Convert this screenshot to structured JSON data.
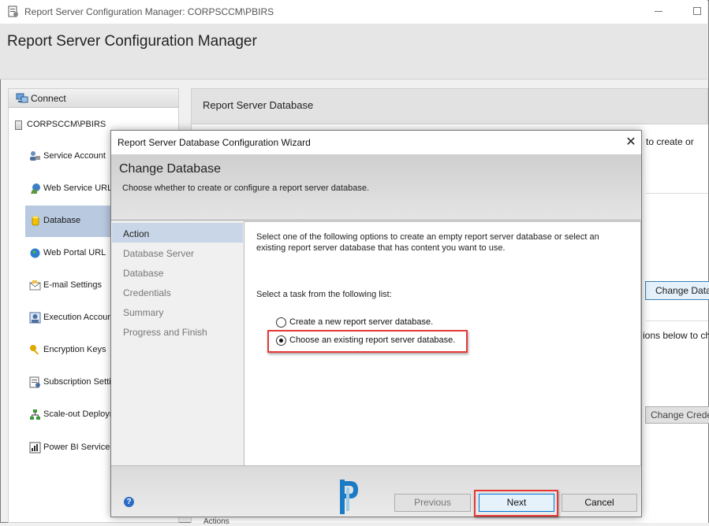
{
  "window": {
    "title": "Report Server Configuration Manager: CORPSCCM\\PBIRS",
    "header_title": "Report Server Configuration Manager"
  },
  "sidebar": {
    "connect_label": "Connect",
    "server_label": "CORPSCCM\\PBIRS",
    "items": [
      {
        "label": "Service Account",
        "icon": "service-account-icon"
      },
      {
        "label": "Web Service URL",
        "icon": "web-service-icon"
      },
      {
        "label": "Database",
        "icon": "database-icon",
        "active": true
      },
      {
        "label": "Web Portal URL",
        "icon": "globe-icon"
      },
      {
        "label": "E-mail Settings",
        "icon": "email-icon"
      },
      {
        "label": "Execution Accoun",
        "icon": "execution-account-icon"
      },
      {
        "label": "Encryption Keys",
        "icon": "key-icon"
      },
      {
        "label": "Subscription Setti",
        "icon": "subscription-icon"
      },
      {
        "label": "Scale-out Deploym",
        "icon": "scale-out-icon"
      },
      {
        "label": "Power BI Service (",
        "icon": "power-bi-icon"
      }
    ]
  },
  "main": {
    "header_title": "Report Server Database",
    "partial_text_1": "to create or",
    "change_database_label": "Change Data",
    "partial_text_2": "ions below to ch",
    "change_credentials_label": "Change Creder",
    "partial_bottom": "Actions"
  },
  "wizard": {
    "title": "Report Server Database Configuration Wizard",
    "heading": "Change Database",
    "subheading": "Choose whether to create or configure a report server database.",
    "steps": [
      "Action",
      "Database Server",
      "Database",
      "Credentials",
      "Summary",
      "Progress and Finish"
    ],
    "active_step": "Action",
    "intro": "Select one of the following options to create an empty report server database or select an existing report server database that has content you want to use.",
    "task_label": "Select a task from the following list:",
    "options": [
      {
        "label": "Create a new report server database.",
        "selected": false
      },
      {
        "label": "Choose an existing report server database.",
        "selected": true
      }
    ],
    "buttons": {
      "previous": "Previous",
      "next": "Next",
      "cancel": "Cancel"
    },
    "help_glyph": "?"
  },
  "colors": {
    "highlight": "#e53935",
    "active_nav": "#b8c9e0",
    "active_step": "#c9d6e7",
    "accent": "#0078d7"
  }
}
